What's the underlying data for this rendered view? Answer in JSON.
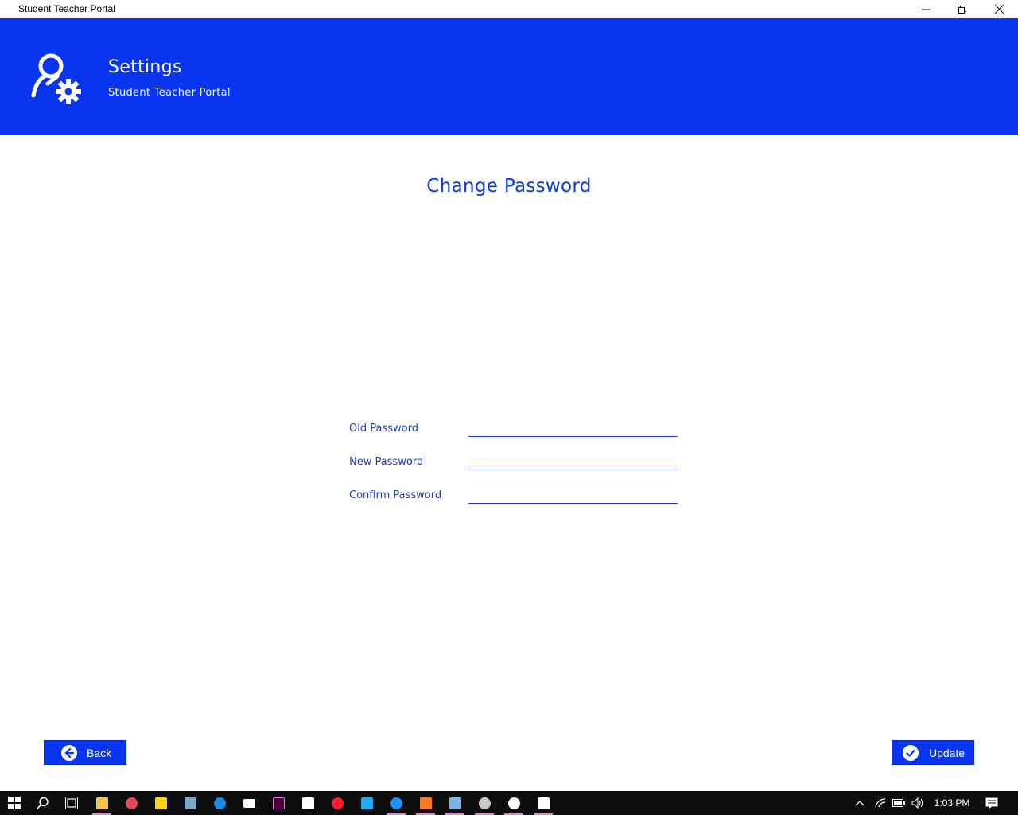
{
  "window": {
    "title": "Student Teacher Portal"
  },
  "header": {
    "title": "Settings",
    "subtitle": "Student Teacher Portal",
    "icon": "user-settings-icon",
    "background_color": "#0a35f0"
  },
  "main": {
    "heading": "Change Password",
    "fields": [
      {
        "label": "Old Password",
        "value": "",
        "placeholder": ""
      },
      {
        "label": "New Password",
        "value": "",
        "placeholder": ""
      },
      {
        "label": "Confirm Password",
        "value": "",
        "placeholder": ""
      }
    ]
  },
  "actions": {
    "back_label": "Back",
    "update_label": "Update"
  },
  "taskbar": {
    "clock": "1:03 PM",
    "apps": [
      "file-explorer-icon",
      "paint-icon",
      "sticky-notes-icon",
      "photos-viewer-icon",
      "edge-icon",
      "mail-icon",
      "adobe-xd-icon",
      "store-icon",
      "opera-icon",
      "vscode-icon",
      "firefox-icon",
      "xampp-icon",
      "virtualbox-icon",
      "app-icon",
      "app-icon",
      "photos-icon"
    ]
  }
}
